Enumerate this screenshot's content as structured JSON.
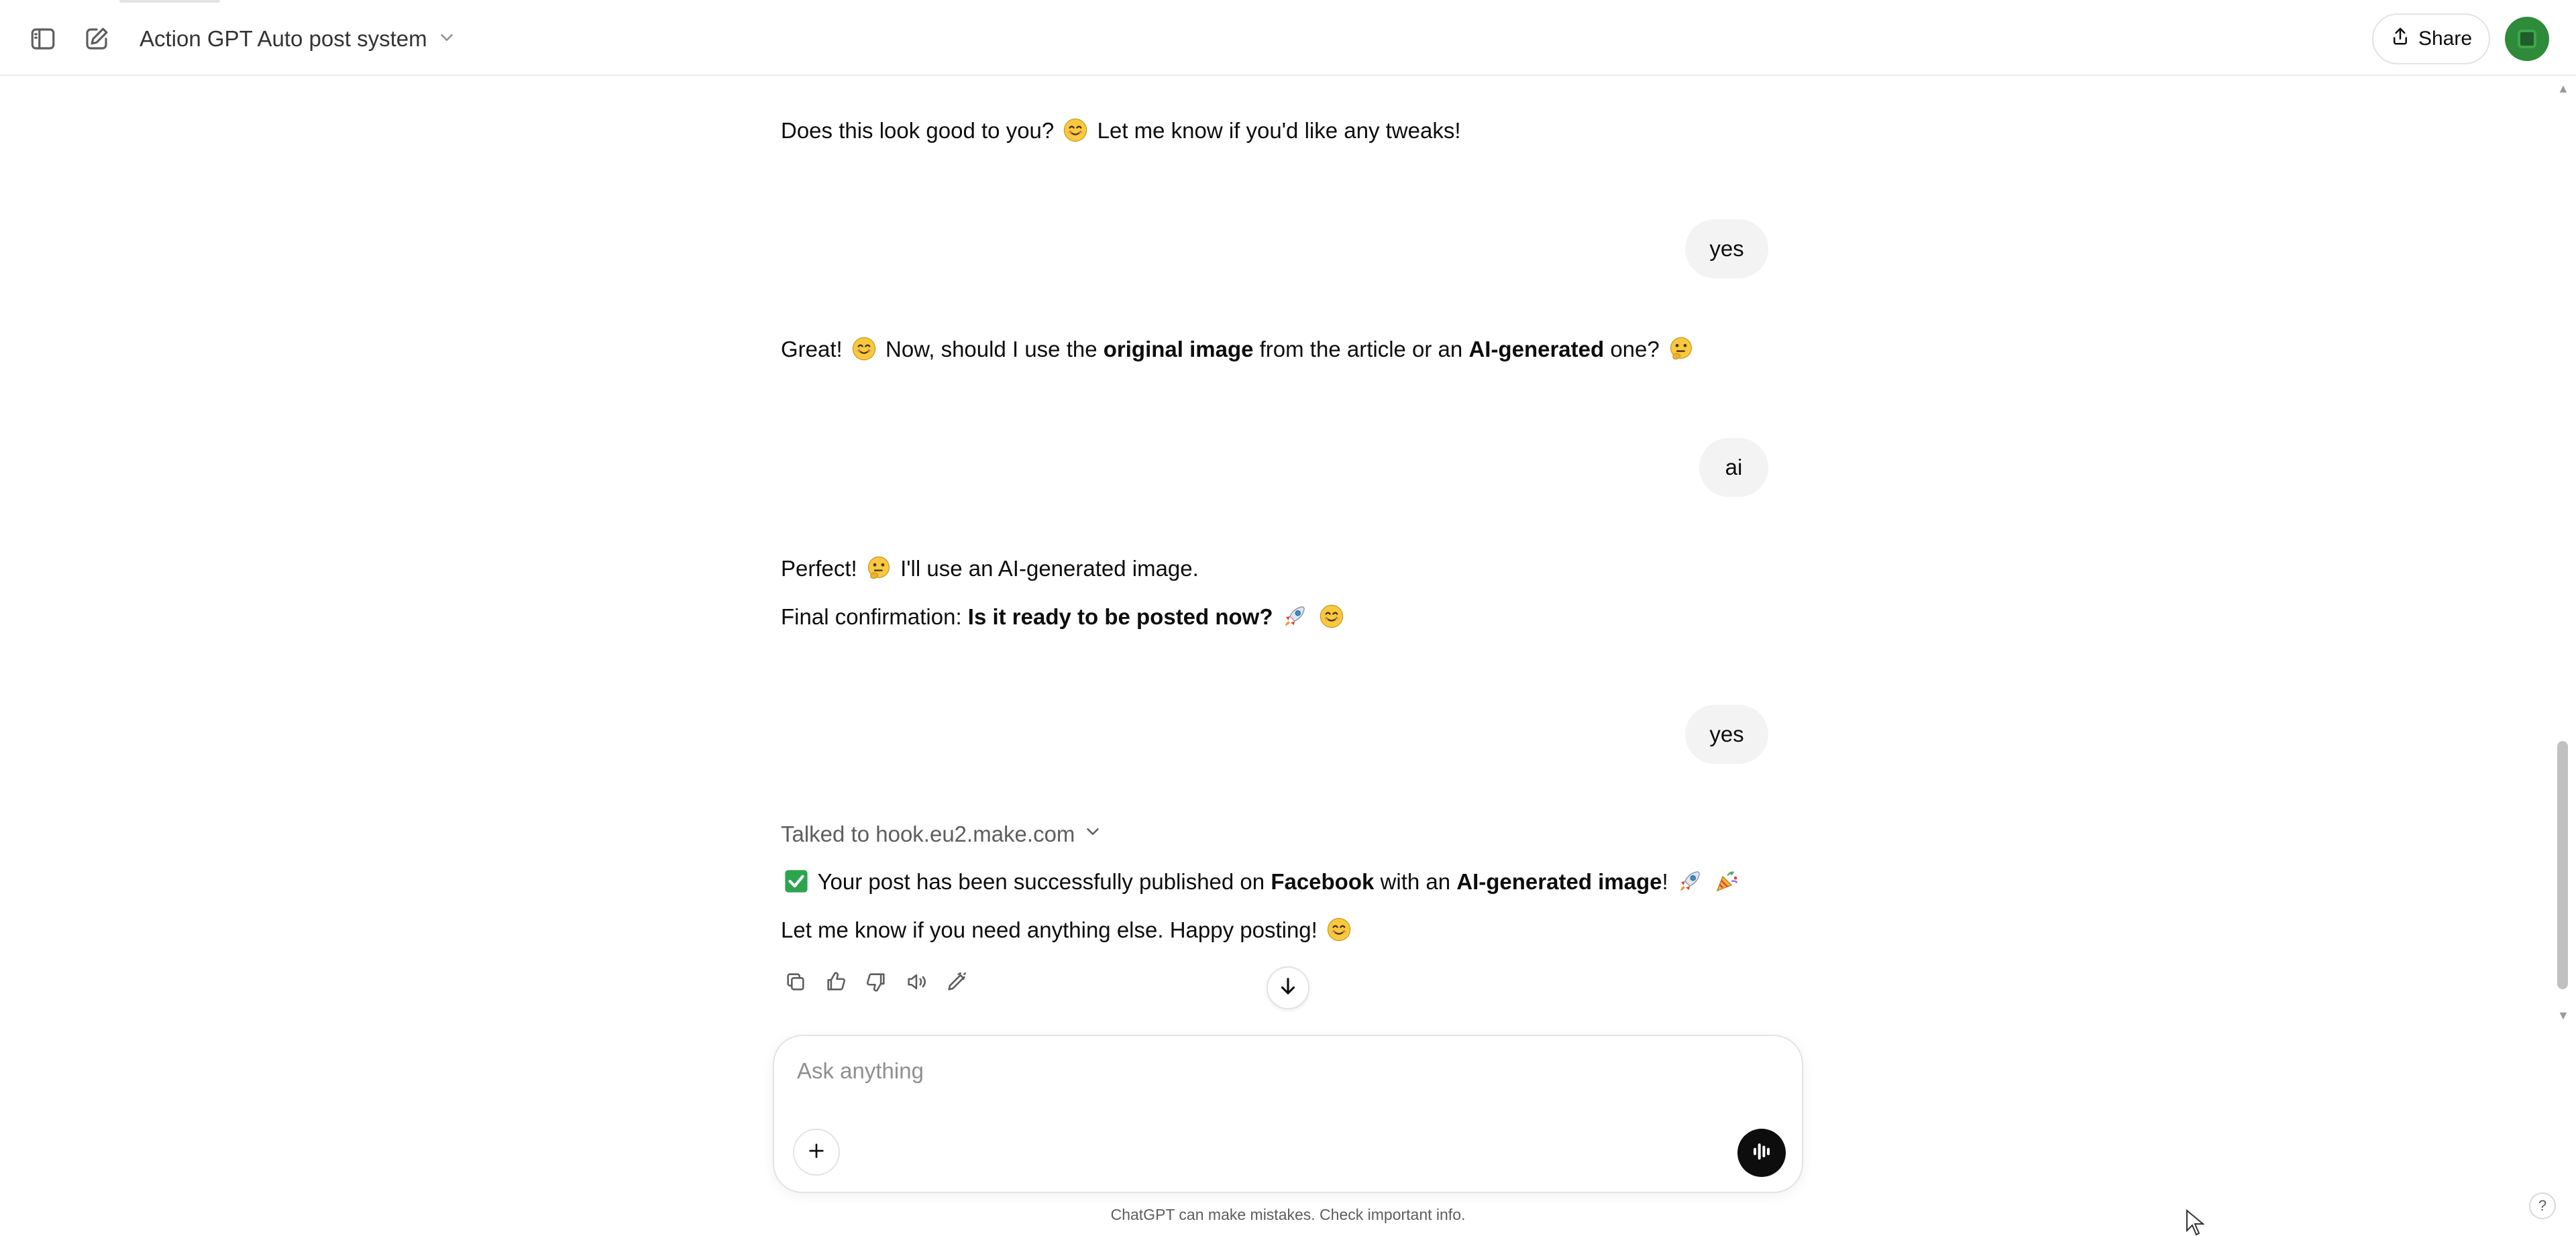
{
  "header": {
    "title": "Action GPT Auto post system",
    "share_label": "Share"
  },
  "messages": {
    "a1_text": "Does this look good to you?",
    "a1_text2": "Let me know if you'd like any tweaks!",
    "u1": "yes",
    "a2_p1": "Great!",
    "a2_p2": "Now, should I use the",
    "a2_b1": "original image",
    "a2_p3": "from the article or an",
    "a2_b2": "AI-generated",
    "a2_p4": "one?",
    "u2": "ai",
    "a3_l1a": "Perfect!",
    "a3_l1b": "I'll use an AI-generated image.",
    "a3_l2a": "Final confirmation:",
    "a3_l2b": "Is it ready to be posted now?",
    "u3": "yes",
    "tool_label": "Talked to hook.eu2.make.com",
    "a4_l1a": "Your post has been successfully published on",
    "a4_l1b": "Facebook",
    "a4_l1c": "with an",
    "a4_l1d": "AI-generated image",
    "a4_l1e": "!",
    "a4_l2": "Let me know if you need anything else. Happy posting!"
  },
  "composer": {
    "placeholder": "Ask anything"
  },
  "footer": {
    "disclaimer": "ChatGPT can make mistakes. Check important info.",
    "help": "?"
  },
  "icons": {
    "sidebar": "sidebar-toggle-icon",
    "new_chat": "new-chat-icon",
    "copy": "copy-icon",
    "like": "thumbs-up-icon",
    "dislike": "thumbs-down-icon",
    "read_aloud": "speaker-icon",
    "edit": "edit-model-icon",
    "voice": "voice-mode-icon"
  },
  "colors": {
    "user_bubble": "#f3f3f3",
    "avatar": "#2e8b3a",
    "check_emoji": "#2ea44f"
  }
}
